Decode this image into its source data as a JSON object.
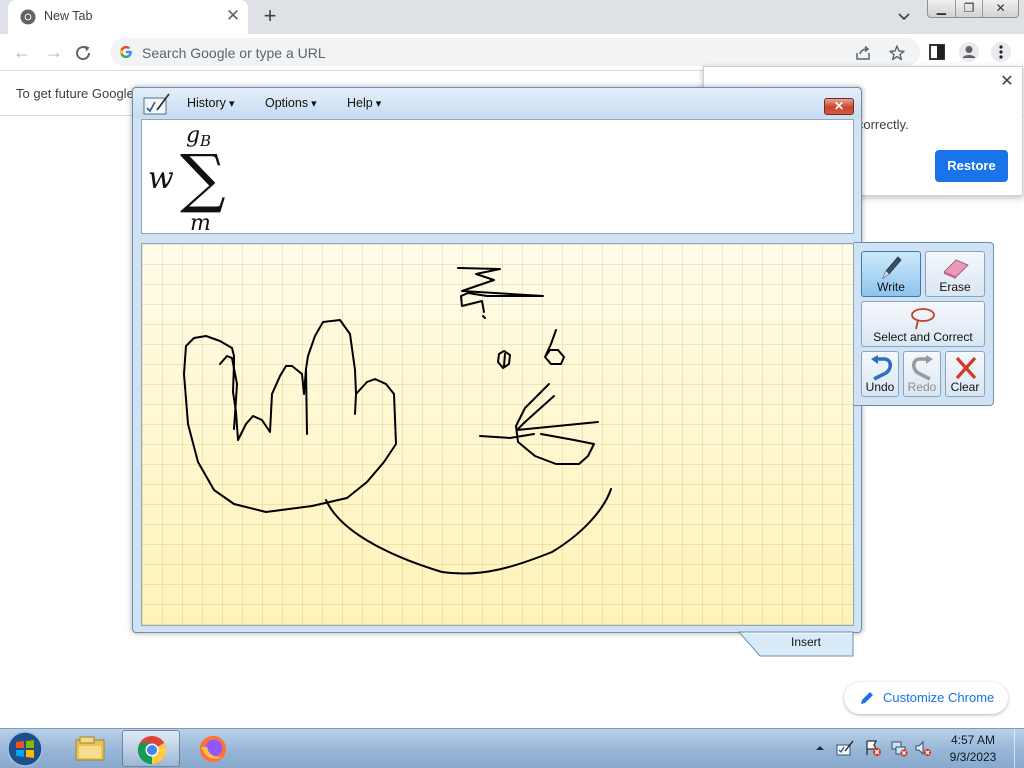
{
  "browser": {
    "tab": {
      "title": "New Tab",
      "close_glyph": "✕",
      "favicon": "chrome-icon"
    },
    "new_tab_glyph": "+",
    "window_controls": {
      "minimize": "▁",
      "restore": "❐",
      "close": "✕"
    },
    "omnibox": {
      "placeholder": "Search Google or type a URL",
      "icon": "google-g-icon"
    },
    "infobar_text": "To get future Google",
    "restore_popup": {
      "message": "n correctly.",
      "button_label": "Restore",
      "close_glyph": "✕"
    },
    "customize_label": "Customize Chrome"
  },
  "math_input_panel": {
    "menus": [
      "History",
      "Options",
      "Help"
    ],
    "close_glyph": "✕",
    "preview": {
      "coefficient": "w",
      "upper_limit": "g",
      "upper_limit_subscript": "B",
      "operator": "∑",
      "lower_limit": "m"
    },
    "tools": {
      "write": "Write",
      "erase": "Erase",
      "select_correct": "Select and Correct",
      "undo": "Undo",
      "redo": "Redo",
      "clear": "Clear"
    },
    "insert_label": "Insert"
  },
  "taskbar": {
    "time": "4:57 AM",
    "date": "9/3/2023",
    "pinned": [
      "file-explorer-icon",
      "chrome-icon",
      "firefox-icon"
    ]
  },
  "colors": {
    "accent": "#1a73e8",
    "canvas": "#fff7d2",
    "panel": "#cfe3f5"
  }
}
